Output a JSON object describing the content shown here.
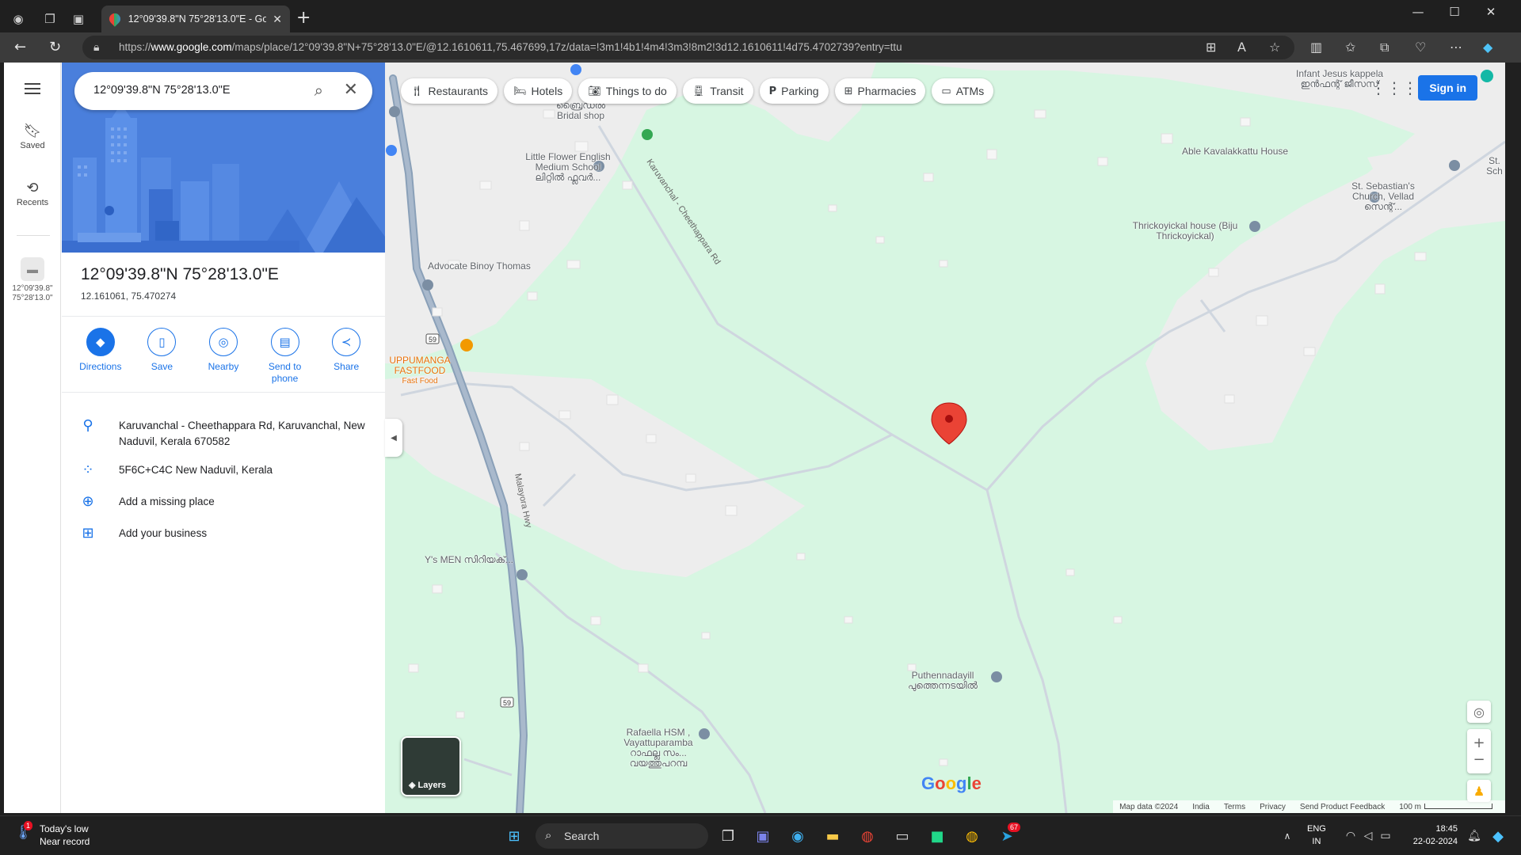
{
  "browser": {
    "tab_title": "12°09'39.8\"N 75°28'13.0\"E - Google Maps",
    "url_prefix": "https://",
    "url_host": "www.google.com",
    "url_path": "/maps/place/12°09'39.8\"N+75°28'13.0\"E/@12.1610611,75.467699,17z/data=!3m1!4b1!4m4!3m3!8m2!3d12.1610611!4d75.4702739?entry=ttu"
  },
  "rail": {
    "saved": "Saved",
    "recents": "Recents",
    "recent_place_line1": "12°09'39.8\"",
    "recent_place_line2": "75°28'13.0\""
  },
  "search": {
    "query": "12°09'39.8\"N 75°28'13.0\"E"
  },
  "place": {
    "title": "12°09'39.8\"N 75°28'13.0\"E",
    "decimal": "12.161061, 75.470274"
  },
  "actions": [
    {
      "label": "Directions"
    },
    {
      "label": "Save"
    },
    {
      "label": "Nearby"
    },
    {
      "label": "Send to phone"
    },
    {
      "label": "Share"
    }
  ],
  "details": {
    "address": "Karuvanchal - Cheethappara Rd, Karuvanchal, New Naduvil, Kerala 670582",
    "plus_code": "5F6C+C4C New Naduvil, Kerala",
    "add_missing": "Add a missing place",
    "add_business": "Add your business"
  },
  "chips": [
    {
      "label": "Restaurants",
      "icon": "fork-knife-icon"
    },
    {
      "label": "Hotels",
      "icon": "bed-icon"
    },
    {
      "label": "Things to do",
      "icon": "camera-icon"
    },
    {
      "label": "Transit",
      "icon": "train-icon"
    },
    {
      "label": "Parking",
      "icon": "parking-icon"
    },
    {
      "label": "Pharmacies",
      "icon": "pharmacy-icon"
    },
    {
      "label": "ATMs",
      "icon": "atm-icon"
    }
  ],
  "map": {
    "sign_in": "Sign in",
    "layers": "Layers",
    "logo": "Google",
    "labels": {
      "infant_jesus": "Infant Jesus kappela",
      "infant_jesus_ml": "ഇൻഫന്റ് ജീസസ്",
      "able_house": "Able Kavalakkattu House",
      "st_sebastian": "St. Sebastian's Church, Vellad",
      "st_sebastian_ml": "സെന്റ്...",
      "st_sch": "St. Sch",
      "thrickoyickal": "Thrickoyickal house (Biju Thrickoyickal)",
      "little_flower": "Little Flower English Medium School",
      "little_flower_ml": "ലിറ്റിൽ ഫ്ലവർ...",
      "bridal": "Bridal shop",
      "bridal_ml": "ബ്രൈഡൽ",
      "advocate": "Advocate Binoy Thomas",
      "uppumanga": "UPPUMANGA FASTFOOD",
      "fast_food": "Fast Food",
      "ys_men": "Y's MEN സിറിയക്...",
      "puthennadayil": "Puthennadayill",
      "puthennadayil_ml": "പുത്തെന്നടയിൽ",
      "rafaella": "Rafaella HSM , Vayattuparamba",
      "rafaella_ml": "റാഫല്ല സം... വയത്തുപറമ്പ",
      "road_karuvanchal": "Karuvanchal - Cheethappara Rd",
      "road_malayora": "Malayora Hwy",
      "route_59": "59"
    },
    "footer": {
      "map_data": "Map data ©2024",
      "india": "India",
      "terms": "Terms",
      "privacy": "Privacy",
      "feedback": "Send Product Feedback",
      "scale": "100 m"
    }
  },
  "taskbar": {
    "weather_line1": "Today's low",
    "weather_line2": "Near record",
    "weather_badge": "1",
    "search": "Search",
    "lang1": "ENG",
    "lang2": "IN",
    "time": "18:45",
    "date": "22-02-2024",
    "telegram_badge": "67"
  }
}
